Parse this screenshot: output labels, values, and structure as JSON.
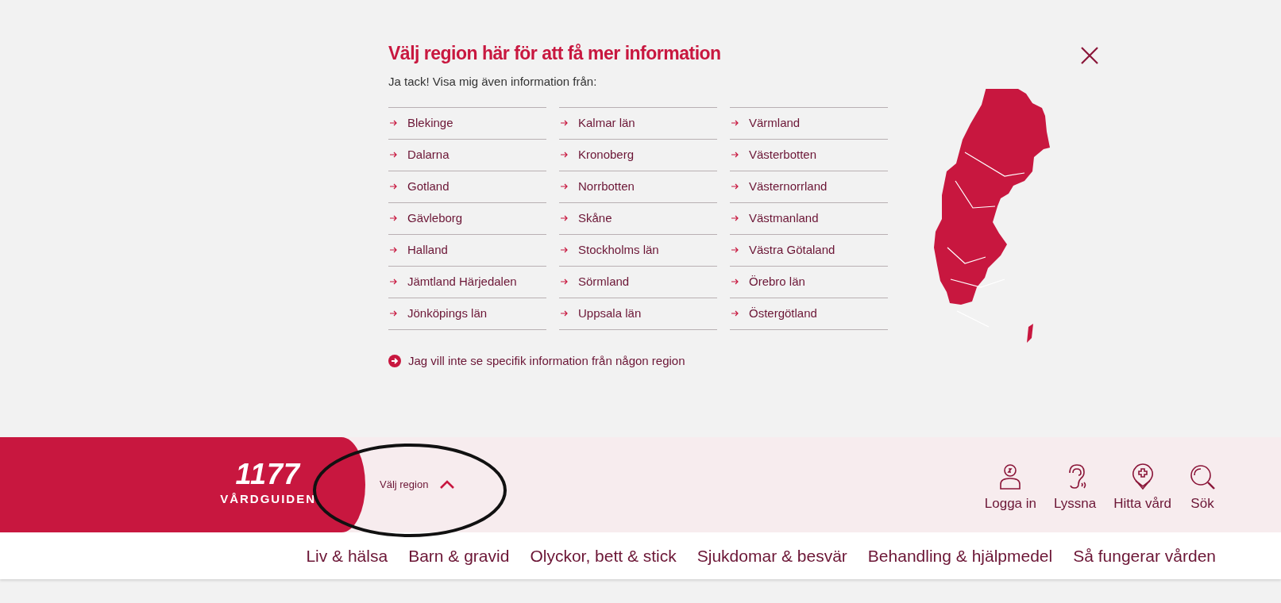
{
  "dialog": {
    "title": "Välj region här för att få mer information",
    "subtitle": "Ja tack! Visa mig även information från:",
    "regions": [
      [
        "Blekinge",
        "Dalarna",
        "Gotland",
        "Gävleborg",
        "Halland",
        "Jämtland Härjedalen",
        "Jönköpings län"
      ],
      [
        "Kalmar län",
        "Kronoberg",
        "Norrbotten",
        "Skåne",
        "Stockholms län",
        "Sörmland",
        "Uppsala län"
      ],
      [
        "Värmland",
        "Västerbotten",
        "Västernorrland",
        "Västmanland",
        "Västra Götaland",
        "Örebro län",
        "Östergötland"
      ]
    ],
    "no_region_link": "Jag vill inte se specifik information från någon region"
  },
  "header": {
    "logo_number": "1177",
    "logo_text": "VÅRDGUIDEN",
    "region_button": {
      "label": "Välj region",
      "expanded": true
    },
    "actions": [
      {
        "kind": "user",
        "label": "Logga in"
      },
      {
        "kind": "ear",
        "label": "Lyssna"
      },
      {
        "kind": "pin",
        "label": "Hitta vård"
      },
      {
        "kind": "search",
        "label": "Sök"
      }
    ]
  },
  "nav": [
    "Liv & hälsa",
    "Barn & gravid",
    "Olyckor, bett & stick",
    "Sjukdomar & besvär",
    "Behandling & hjälpmedel",
    "Så fungerar vården"
  ]
}
